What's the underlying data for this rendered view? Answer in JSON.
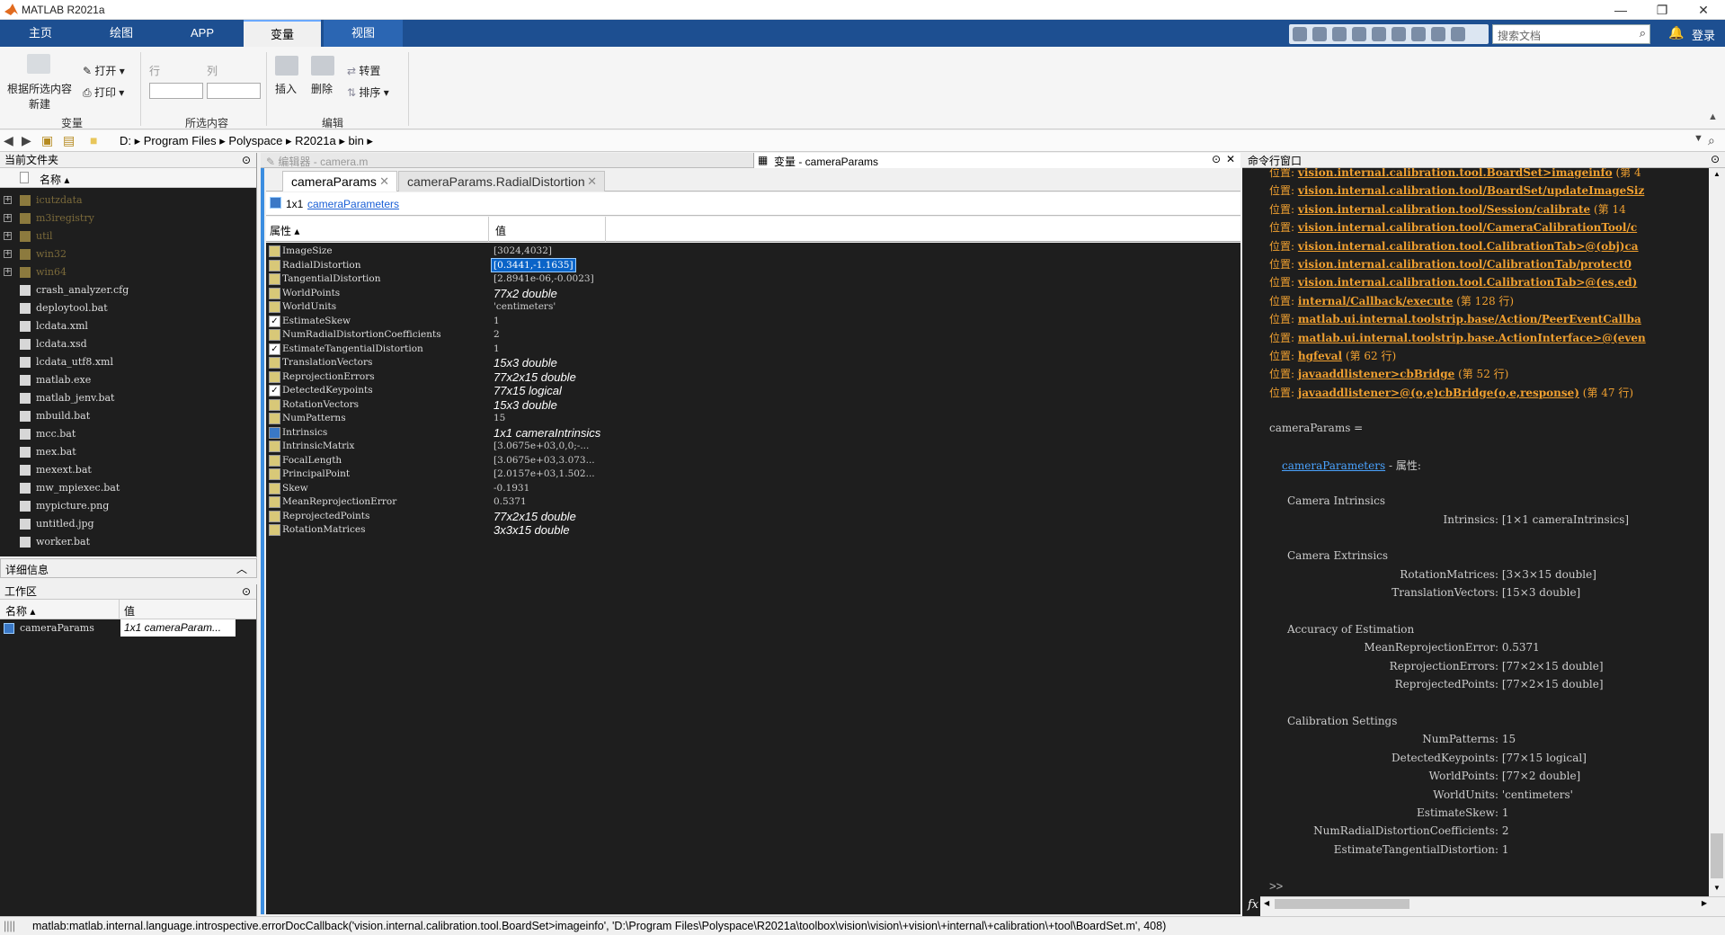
{
  "window": {
    "title": "MATLAB R2021a",
    "controls": [
      "—",
      "❐",
      "✕"
    ]
  },
  "ribbon_tabs": [
    {
      "label": "主页",
      "active": false
    },
    {
      "label": "绘图",
      "active": false
    },
    {
      "label": "APP",
      "active": false
    },
    {
      "label": "变量",
      "active": true
    },
    {
      "label": "视图",
      "active": false
    }
  ],
  "search": {
    "placeholder": "搜索文档"
  },
  "login_label": "登录",
  "ribbon": {
    "new_from_selection": "根据所选内容",
    "new_label": "新建",
    "open_label": "打开",
    "print_label": "打印",
    "row_label": "行",
    "col_label": "列",
    "insert_label": "插入",
    "delete_label": "删除",
    "transpose_label": "转置",
    "sort_label": "排序",
    "groups": {
      "variable": "变量",
      "selection": "所选内容",
      "edit": "编辑"
    }
  },
  "address": {
    "crumbs": [
      "D:",
      "Program Files",
      "Polyspace",
      "R2021a",
      "bin"
    ]
  },
  "current_folder": {
    "title": "当前文件夹",
    "name_header": "名称",
    "items": [
      {
        "name": "icutzdata",
        "type": "folder"
      },
      {
        "name": "m3iregistry",
        "type": "folder"
      },
      {
        "name": "util",
        "type": "folder"
      },
      {
        "name": "win32",
        "type": "folder"
      },
      {
        "name": "win64",
        "type": "folder"
      },
      {
        "name": "crash_analyzer.cfg",
        "type": "file"
      },
      {
        "name": "deploytool.bat",
        "type": "file"
      },
      {
        "name": "lcdata.xml",
        "type": "file"
      },
      {
        "name": "lcdata.xsd",
        "type": "file"
      },
      {
        "name": "lcdata_utf8.xml",
        "type": "file"
      },
      {
        "name": "matlab.exe",
        "type": "file"
      },
      {
        "name": "matlab_jenv.bat",
        "type": "file"
      },
      {
        "name": "mbuild.bat",
        "type": "file"
      },
      {
        "name": "mcc.bat",
        "type": "file"
      },
      {
        "name": "mex.bat",
        "type": "file"
      },
      {
        "name": "mexext.bat",
        "type": "file"
      },
      {
        "name": "mw_mpiexec.bat",
        "type": "file"
      },
      {
        "name": "mypicture.png",
        "type": "file"
      },
      {
        "name": "untitled.jpg",
        "type": "file"
      },
      {
        "name": "worker.bat",
        "type": "file"
      }
    ]
  },
  "details": {
    "title": "详细信息"
  },
  "workspace": {
    "title": "工作区",
    "name_header": "名称",
    "value_header": "值",
    "rows": [
      {
        "name": "cameraParams",
        "value": "1x1 cameraParam..."
      }
    ]
  },
  "editor_tab": {
    "label": "编辑器 - camera.m"
  },
  "var_editor": {
    "title": "变量 - cameraParams",
    "tabs": [
      {
        "label": "cameraParams",
        "active": true
      },
      {
        "label": "cameraParams.RadialDistortion",
        "active": false
      }
    ],
    "size_label": "1x1",
    "class_link": "cameraParameters",
    "prop_header": "属性",
    "value_header": "值",
    "props": [
      {
        "name": "ImageSize",
        "value": "[3024,4032]",
        "italic": false,
        "icon": "grid"
      },
      {
        "name": "RadialDistortion",
        "value": "[0.3441,-1.1635]",
        "italic": false,
        "icon": "grid",
        "selected": true
      },
      {
        "name": "TangentialDistortion",
        "value": "[2.8941e-06,-0.0023]",
        "italic": false,
        "icon": "grid"
      },
      {
        "name": "WorldPoints",
        "value": "77x2 double",
        "italic": true,
        "icon": "grid"
      },
      {
        "name": "WorldUnits",
        "value": "'centimeters'",
        "italic": false,
        "icon": "grid"
      },
      {
        "name": "EstimateSkew",
        "value": "1",
        "italic": false,
        "icon": "check"
      },
      {
        "name": "NumRadialDistortionCoefficients",
        "value": "2",
        "italic": false,
        "icon": "grid"
      },
      {
        "name": "EstimateTangentialDistortion",
        "value": "1",
        "italic": false,
        "icon": "check"
      },
      {
        "name": "TranslationVectors",
        "value": "15x3 double",
        "italic": true,
        "icon": "grid"
      },
      {
        "name": "ReprojectionErrors",
        "value": "77x2x15 double",
        "italic": true,
        "icon": "grid"
      },
      {
        "name": "DetectedKeypoints",
        "value": "77x15 logical",
        "italic": true,
        "icon": "check"
      },
      {
        "name": "RotationVectors",
        "value": "15x3 double",
        "italic": true,
        "icon": "grid"
      },
      {
        "name": "NumPatterns",
        "value": "15",
        "italic": false,
        "icon": "grid"
      },
      {
        "name": "Intrinsics",
        "value": "1x1 cameraIntrinsics",
        "italic": true,
        "icon": "obj"
      },
      {
        "name": "IntrinsicMatrix",
        "value": "[3.0675e+03,0,0;-...",
        "italic": false,
        "icon": "grid"
      },
      {
        "name": "FocalLength",
        "value": "[3.0675e+03,3.073...",
        "italic": false,
        "icon": "grid"
      },
      {
        "name": "PrincipalPoint",
        "value": "[2.0157e+03,1.502...",
        "italic": false,
        "icon": "grid"
      },
      {
        "name": "Skew",
        "value": "-0.1931",
        "italic": false,
        "icon": "grid"
      },
      {
        "name": "MeanReprojectionError",
        "value": "0.5371",
        "italic": false,
        "icon": "grid"
      },
      {
        "name": "ReprojectedPoints",
        "value": "77x2x15 double",
        "italic": true,
        "icon": "grid"
      },
      {
        "name": "RotationMatrices",
        "value": "3x3x15 double",
        "italic": true,
        "icon": "grid"
      }
    ]
  },
  "command_window": {
    "title": "命令行窗口",
    "trace": [
      {
        "prefix": "位置:",
        "link": "vision.internal.calibration.tool.BoardSet>imageinfo",
        "suffix": "(第 4"
      },
      {
        "prefix": "位置:",
        "link": "vision.internal.calibration.tool/BoardSet/updateImageSiz",
        "suffix": ""
      },
      {
        "prefix": "位置:",
        "link": "vision.internal.calibration.tool/Session/calibrate",
        "suffix": "(第 14"
      },
      {
        "prefix": "位置:",
        "link": "vision.internal.calibration.tool/CameraCalibrationTool/c",
        "suffix": ""
      },
      {
        "prefix": "位置:",
        "link": "vision.internal.calibration.tool.CalibrationTab>@(obj)ca",
        "suffix": ""
      },
      {
        "prefix": "位置:",
        "link": "vision.internal.calibration.tool/CalibrationTab/protect0",
        "suffix": ""
      },
      {
        "prefix": "位置:",
        "link": "vision.internal.calibration.tool.CalibrationTab>@(es,ed)",
        "suffix": ""
      },
      {
        "prefix": "位置:",
        "link": "internal/Callback/execute",
        "suffix": "(第 128 行)"
      },
      {
        "prefix": "位置:",
        "link": "matlab.ui.internal.toolstrip.base/Action/PeerEventCallba",
        "suffix": ""
      },
      {
        "prefix": "位置:",
        "link": "matlab.ui.internal.toolstrip.base.ActionInterface>@(even",
        "suffix": ""
      },
      {
        "prefix": "位置:",
        "link": "hgfeval",
        "suffix": "(第 62 行)"
      },
      {
        "prefix": "位置:",
        "link": "javaaddlistener>cbBridge",
        "suffix": "(第 52 行)"
      },
      {
        "prefix": "位置:",
        "link": "javaaddlistener>@(o,e)cbBridge(o,e,response)",
        "suffix": "(第 47 行)"
      }
    ],
    "assign_line": "cameraParams =",
    "class_link": "cameraParameters",
    "class_suffix": "- 属性:",
    "sections": [
      {
        "title": "Camera Intrinsics",
        "fields": [
          {
            "k": "Intrinsics:",
            "v": "[1×1 cameraIntrinsics]"
          }
        ]
      },
      {
        "title": "Camera Extrinsics",
        "fields": [
          {
            "k": "RotationMatrices:",
            "v": "[3×3×15 double]"
          },
          {
            "k": "TranslationVectors:",
            "v": "[15×3 double]"
          }
        ]
      },
      {
        "title": "Accuracy of Estimation",
        "fields": [
          {
            "k": "MeanReprojectionError:",
            "v": "0.5371"
          },
          {
            "k": "ReprojectionErrors:",
            "v": "[77×2×15 double]"
          },
          {
            "k": "ReprojectedPoints:",
            "v": "[77×2×15 double]"
          }
        ]
      },
      {
        "title": "Calibration Settings",
        "fields": [
          {
            "k": "NumPatterns:",
            "v": "15"
          },
          {
            "k": "DetectedKeypoints:",
            "v": "[77×15 logical]"
          },
          {
            "k": "WorldPoints:",
            "v": "[77×2 double]"
          },
          {
            "k": "WorldUnits:",
            "v": "'centimeters'"
          },
          {
            "k": "EstimateSkew:",
            "v": "1"
          },
          {
            "k": "NumRadialDistortionCoefficients:",
            "v": "2"
          },
          {
            "k": "EstimateTangentialDistortion:",
            "v": "1"
          }
        ]
      }
    ],
    "prompt_fx": "fx",
    "prompt": ">>"
  },
  "status_bar": {
    "text": "matlab:matlab.internal.language.introspective.errorDocCallback('vision.internal.calibration.tool.BoardSet>imageinfo', 'D:\\Program Files\\Polyspace\\R2021a\\toolbox\\vision\\vision\\+vision\\+internal\\+calibration\\+tool\\BoardSet.m', 408)"
  },
  "colors": {
    "ribbon_bar": "#1d4f91",
    "dark_bg": "#1e1e1e",
    "link_orange": "#f0a030",
    "link_blue": "#4aa3ff",
    "selection": "#0a64c8"
  }
}
